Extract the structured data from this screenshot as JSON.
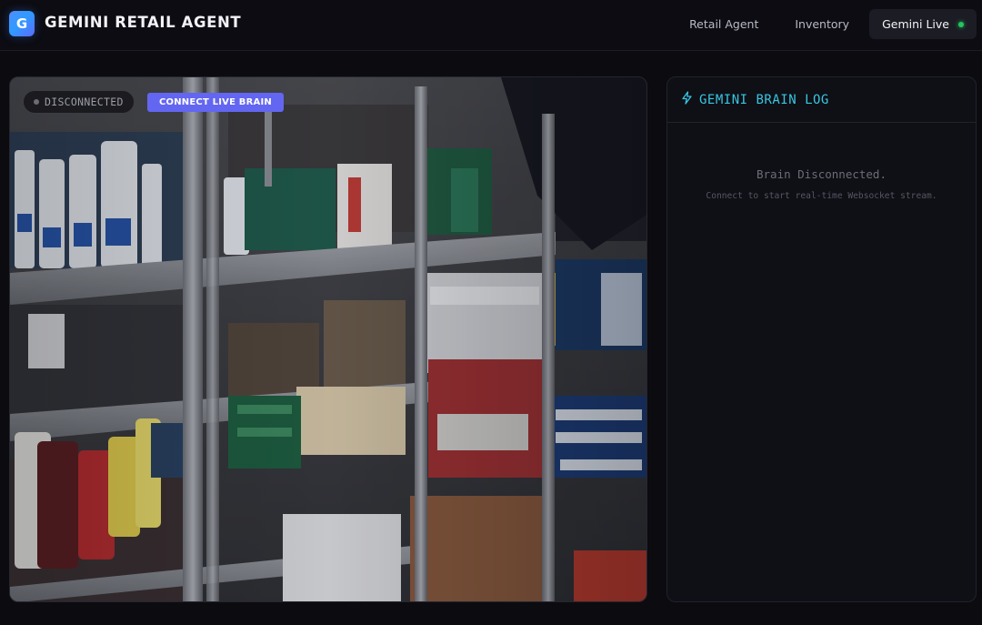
{
  "header": {
    "logo_letter": "G",
    "title": "GEMINI RETAIL AGENT",
    "nav": [
      {
        "label": "Retail Agent"
      },
      {
        "label": "Inventory"
      },
      {
        "label": "Gemini Live",
        "active": true,
        "indicator_color": "#22c55e"
      }
    ]
  },
  "camera": {
    "status_label": "DISCONNECTED",
    "connect_button_label": "CONNECT LIVE BRAIN"
  },
  "brain_log": {
    "icon": "lightning-icon",
    "title": "GEMINI BRAIN LOG",
    "empty_title": "Brain Disconnected.",
    "empty_subtitle": "Connect to start real-time Websocket stream."
  },
  "colors": {
    "accent": "#6366f1",
    "log_title": "#38c6e0",
    "live_indicator": "#22c55e"
  }
}
